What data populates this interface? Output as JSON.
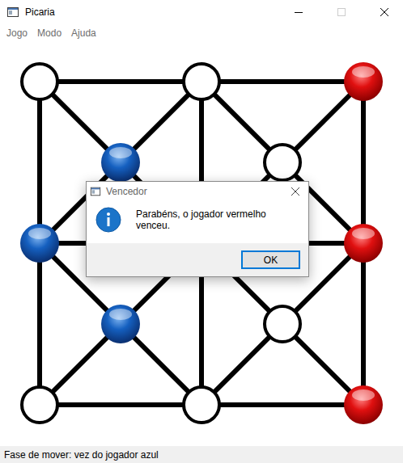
{
  "window": {
    "title": "Picaria",
    "maximize_disabled": true
  },
  "menu": [
    {
      "label": "Jogo",
      "disabled": true
    },
    {
      "label": "Modo",
      "disabled": true
    },
    {
      "label": "Ajuda",
      "disabled": true
    }
  ],
  "board": {
    "points": [
      {
        "piece": "empty"
      },
      {
        "piece": "empty"
      },
      {
        "piece": "red"
      },
      {
        "piece": "blue"
      },
      {
        "piece": "empty"
      },
      {
        "piece": "blue"
      },
      {
        "piece": "empty"
      },
      {
        "piece": "red"
      },
      {
        "piece": "blue"
      },
      {
        "piece": "empty"
      },
      {
        "piece": "empty"
      },
      {
        "piece": "empty"
      },
      {
        "piece": "red"
      }
    ]
  },
  "dialog": {
    "title": "Vencedor",
    "message": "Parabéns, o jogador vermelho venceu.",
    "buttons": [
      "OK"
    ]
  },
  "status_bar": "Fase de mover: vez do jogador azul"
}
